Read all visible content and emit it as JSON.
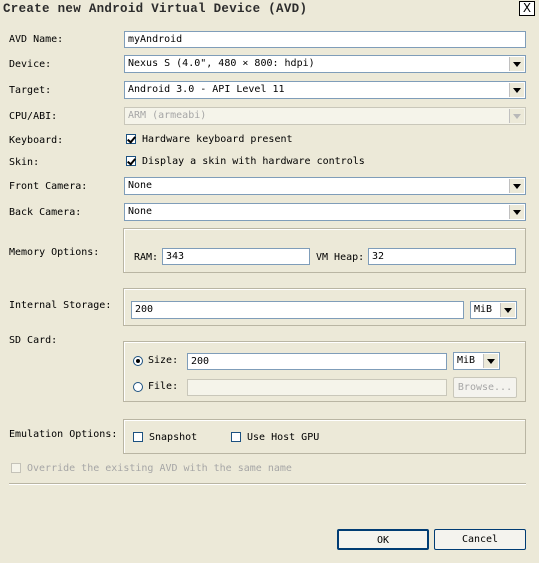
{
  "window": {
    "title": "Create new Android Virtual Device (AVD)",
    "close_label": "X"
  },
  "labels": {
    "avd_name": "AVD Name:",
    "device": "Device:",
    "target": "Target:",
    "cpu_abi": "CPU/ABI:",
    "keyboard": "Keyboard:",
    "skin": "Skin:",
    "front_camera": "Front Camera:",
    "back_camera": "Back Camera:",
    "memory_options": "Memory Options:",
    "internal_storage": "Internal Storage:",
    "sd_card": "SD Card:",
    "emulation_options": "Emulation Options:"
  },
  "fields": {
    "avd_name": "myAndroid",
    "device": "Nexus S (4.0\", 480 × 800: hdpi)",
    "target": "Android 3.0 - API Level 11",
    "cpu_abi": "ARM (armeabi)",
    "keyboard_label": "Hardware keyboard present",
    "keyboard_checked": true,
    "skin_label": "Display a skin with hardware controls",
    "skin_checked": true,
    "front_camera": "None",
    "back_camera": "None"
  },
  "memory": {
    "ram_label": "RAM:",
    "ram": "343",
    "vm_heap_label": "VM Heap:",
    "vm_heap": "32"
  },
  "storage": {
    "internal": "200",
    "internal_unit": "MiB"
  },
  "sdcard": {
    "size_label": "Size:",
    "size": "200",
    "size_unit": "MiB",
    "size_selected": true,
    "file_label": "File:",
    "file": "",
    "browse_label": "Browse..."
  },
  "emulation": {
    "snapshot_label": "Snapshot",
    "host_gpu_label": "Use Host GPU"
  },
  "override_label": "Override the existing AVD with the same name",
  "buttons": {
    "ok": "OK",
    "cancel": "Cancel"
  }
}
